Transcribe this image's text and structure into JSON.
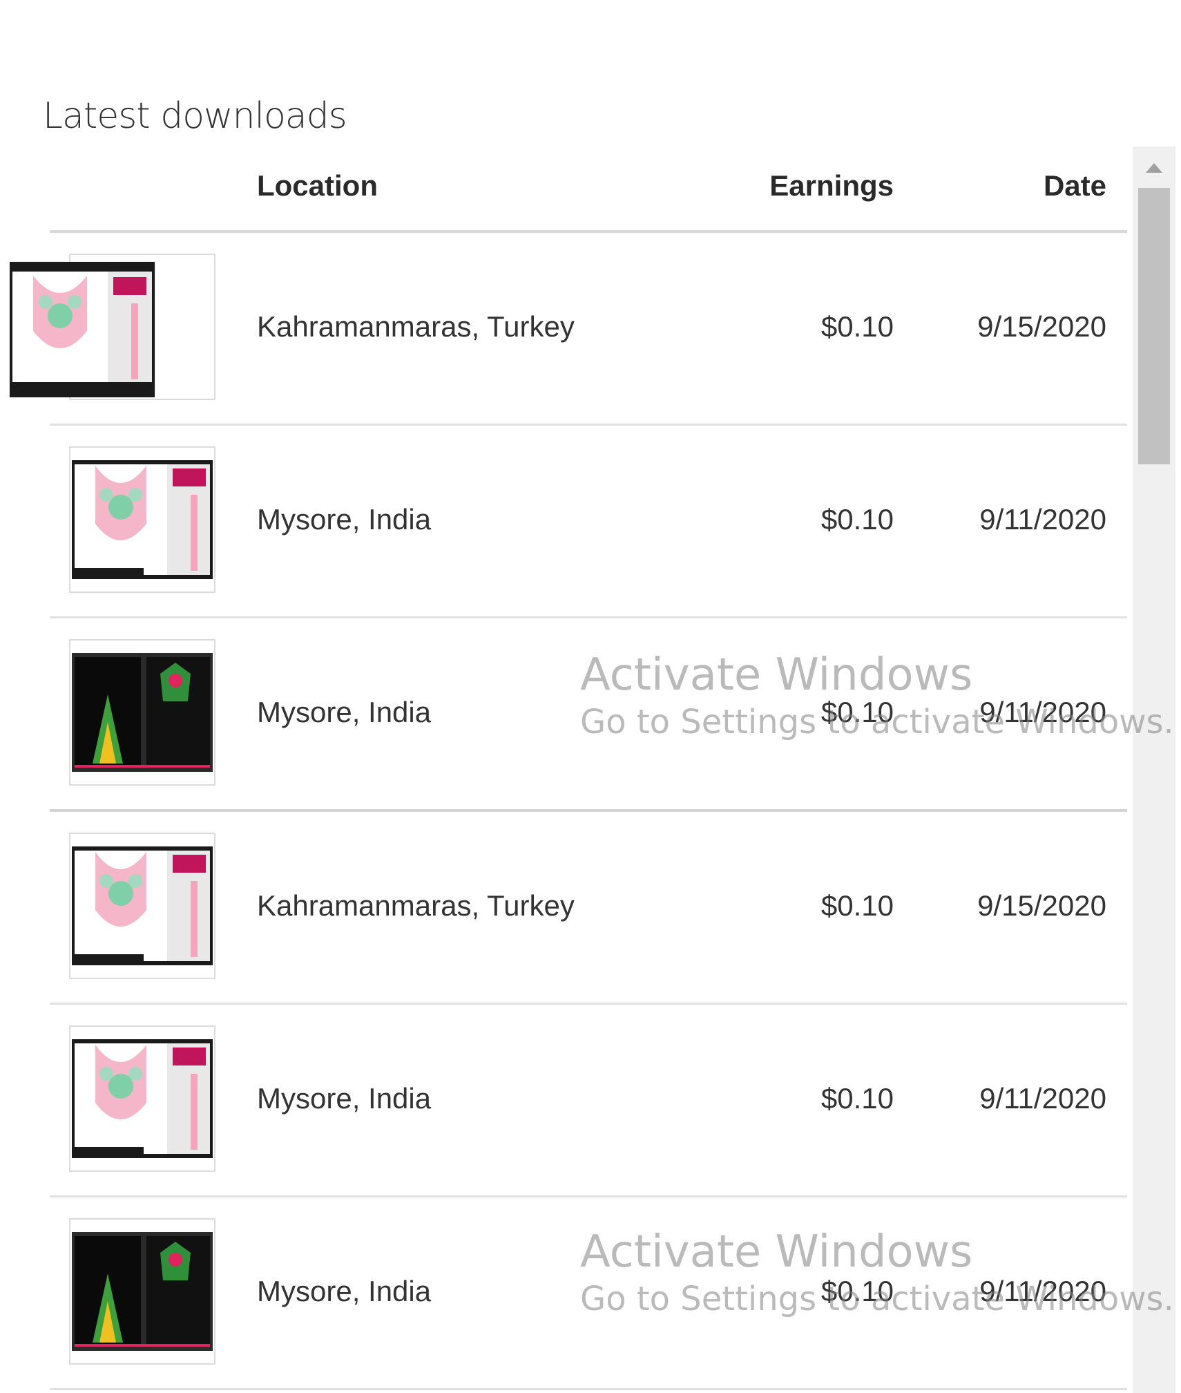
{
  "section": {
    "title": "Latest downloads"
  },
  "table": {
    "headers": {
      "location": "Location",
      "earnings": "Earnings",
      "date": "Date"
    },
    "rows": [
      {
        "location": "Kahramanmaras, Turkey",
        "earnings": "$0.10",
        "date": "9/15/2020",
        "thumb": "light-embroidery"
      },
      {
        "location": "Mysore, India",
        "earnings": "$0.10",
        "date": "9/11/2020",
        "thumb": "light-embroidery"
      },
      {
        "location": "Mysore, India",
        "earnings": "$0.10",
        "date": "9/11/2020",
        "thumb": "dark-embroidery"
      },
      {
        "location": "Kahramanmaras, Turkey",
        "earnings": "$0.10",
        "date": "9/15/2020",
        "thumb": "light-embroidery"
      },
      {
        "location": "Mysore, India",
        "earnings": "$0.10",
        "date": "9/11/2020",
        "thumb": "light-embroidery"
      },
      {
        "location": "Mysore, India",
        "earnings": "$0.10",
        "date": "9/11/2020",
        "thumb": "dark-embroidery"
      }
    ]
  },
  "watermark": {
    "line1": "Activate Windows",
    "line2": "Go to Settings to activate Windows."
  },
  "icons": {
    "scroll_up": "triangle-up-icon"
  }
}
